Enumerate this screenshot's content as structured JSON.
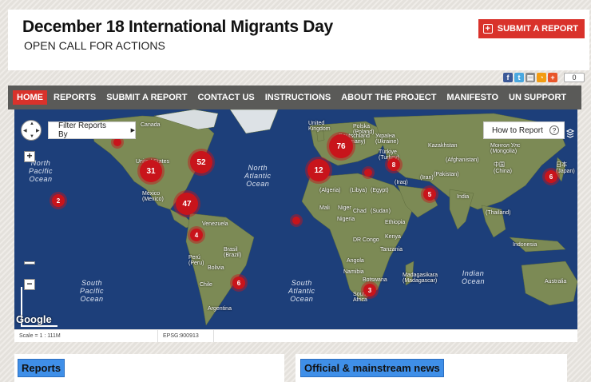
{
  "header": {
    "title": "December 18 International Migrants Day",
    "subtitle": "OPEN CALL FOR ACTIONS",
    "submit_button": "SUBMIT A REPORT"
  },
  "social": {
    "count": "0",
    "icons": [
      "facebook-icon",
      "twitter-icon",
      "print-icon",
      "rss-icon",
      "share-plus-icon"
    ]
  },
  "nav": {
    "items": [
      {
        "label": "HOME",
        "active": true
      },
      {
        "label": "REPORTS"
      },
      {
        "label": "SUBMIT A REPORT"
      },
      {
        "label": "CONTACT US"
      },
      {
        "label": "INSTRUCTIONS"
      },
      {
        "label": "ABOUT THE PROJECT"
      },
      {
        "label": "MANIFESTO"
      },
      {
        "label": "UN SUPPORT"
      }
    ]
  },
  "map": {
    "filter_label": "Filter Reports By",
    "howto_label": "How to Report",
    "howto_icon": "?",
    "google_label": "Google",
    "scale_label": "Scale = 1 : 111M",
    "epsg_label": "EPSG:900913",
    "colors": {
      "ocean": "#1d3f7a",
      "land": "#7c8a55",
      "cluster": "#c8141b",
      "nav_active": "#d9322b"
    },
    "oceans": [
      {
        "name": "North\nPacific\nOcean"
      },
      {
        "name": "North\nAtlantic\nOcean"
      },
      {
        "name": "South\nPacific\nOcean"
      },
      {
        "name": "South\nAtlantic\nOcean"
      },
      {
        "name": "Indian\nOcean"
      }
    ],
    "places": [
      "Canada",
      "United States",
      "México\n(Mexico)",
      "Venezuela",
      "Perú\n(Peru)",
      "Brasil\n(Brazil)",
      "Bolivia",
      "Chile",
      "Argentina",
      "United\nKingdom",
      "Polska\n(Poland)",
      "Україна\n(Ukraine)",
      "Deutschland\n(Germany)",
      "Türkiye\n(Turkey)",
      "Kazakhstan",
      "Монгол Улс\n(Mongolia)",
      "中国\n(China)",
      "日本\n(Japan)",
      "(Algeria)",
      "(Libya)",
      "(Egypt)",
      "(Iraq)",
      "(Iran)",
      "(Afghanistan)",
      "(Pakistan)",
      "India",
      "Mali",
      "Niger",
      "Chad",
      "Nigeria",
      "(Sudan)",
      "Ethiopia",
      "Kenya",
      "DR Congo",
      "Tanzania",
      "Angola",
      "Namibia",
      "Botswana",
      "Madagasikara\n(Madagascar)",
      "South\nAfrica",
      "Indonesia",
      "Australia",
      "(Thailand)"
    ],
    "clusters": [
      {
        "label": "31"
      },
      {
        "label": "52"
      },
      {
        "label": "2"
      },
      {
        "label": "47"
      },
      {
        "label": "4"
      },
      {
        "label": "6"
      },
      {
        "label": "76"
      },
      {
        "label": "12"
      },
      {
        "label": "8"
      },
      {
        "label": "5"
      },
      {
        "label": "6"
      },
      {
        "label": "3"
      },
      {
        "label": ""
      },
      {
        "label": ""
      },
      {
        "label": ""
      }
    ]
  },
  "panels": {
    "reports": "Reports",
    "news": "Official & mainstream news"
  }
}
